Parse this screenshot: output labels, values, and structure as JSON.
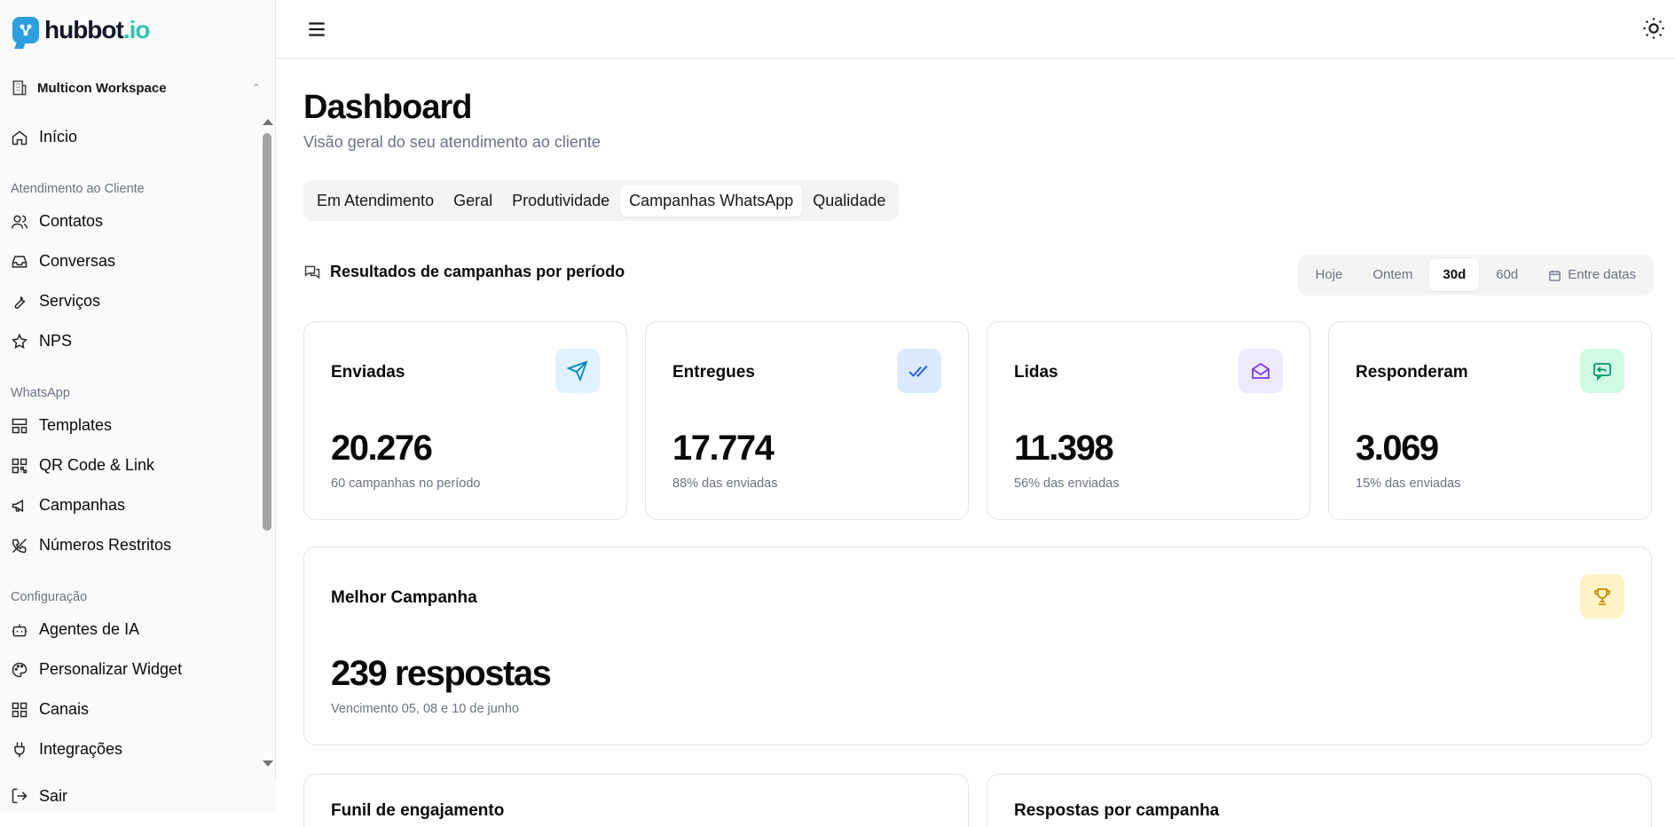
{
  "brand": {
    "name": "hubbot",
    "suffix": ".io"
  },
  "workspace": {
    "name": "Multicon Workspace"
  },
  "sidebar": {
    "home": "Início",
    "sections": [
      {
        "title": "Atendimento ao Cliente",
        "items": [
          "Contatos",
          "Conversas",
          "Serviços",
          "NPS"
        ]
      },
      {
        "title": "WhatsApp",
        "items": [
          "Templates",
          "QR Code & Link",
          "Campanhas",
          "Números Restritos"
        ]
      },
      {
        "title": "Configuração",
        "items": [
          "Agentes de IA",
          "Personalizar Widget",
          "Canais",
          "Integrações"
        ]
      }
    ],
    "logout": "Sair"
  },
  "page": {
    "title": "Dashboard",
    "subtitle": "Visão geral do seu atendimento ao cliente"
  },
  "tabs": [
    "Em Atendimento",
    "Geral",
    "Produtividade",
    "Campanhas WhatsApp",
    "Qualidade"
  ],
  "active_tab": "Campanhas WhatsApp",
  "section": {
    "title": "Resultados de campanhas por período"
  },
  "range": {
    "options": [
      "Hoje",
      "Ontem",
      "30d",
      "60d"
    ],
    "custom": "Entre datas",
    "selected": "30d"
  },
  "stats": [
    {
      "label": "Enviadas",
      "value": "20.276",
      "note": "60 campanhas no período",
      "icon": "send-icon",
      "color": "#0284c7",
      "bg": "#e0f2fe"
    },
    {
      "label": "Entregues",
      "value": "17.774",
      "note": "88% das enviadas",
      "icon": "double-check-icon",
      "color": "#2563eb",
      "bg": "#dbeafe"
    },
    {
      "label": "Lidas",
      "value": "11.398",
      "note": "56% das enviadas",
      "icon": "mail-open-icon",
      "color": "#7c3aed",
      "bg": "#ede9fe"
    },
    {
      "label": "Responderam",
      "value": "3.069",
      "note": "15% das enviadas",
      "icon": "message-reply-icon",
      "color": "#059669",
      "bg": "#d1fae5"
    }
  ],
  "best_campaign": {
    "label": "Melhor Campanha",
    "value": "239 respostas",
    "note": "Vencimento 05, 08 e 10 de junho",
    "icon": "trophy-icon",
    "color": "#ca8a04",
    "bg": "#fef3c7"
  },
  "bottom_cards": {
    "left": "Funil de engajamento",
    "right": "Respostas por campanha"
  }
}
